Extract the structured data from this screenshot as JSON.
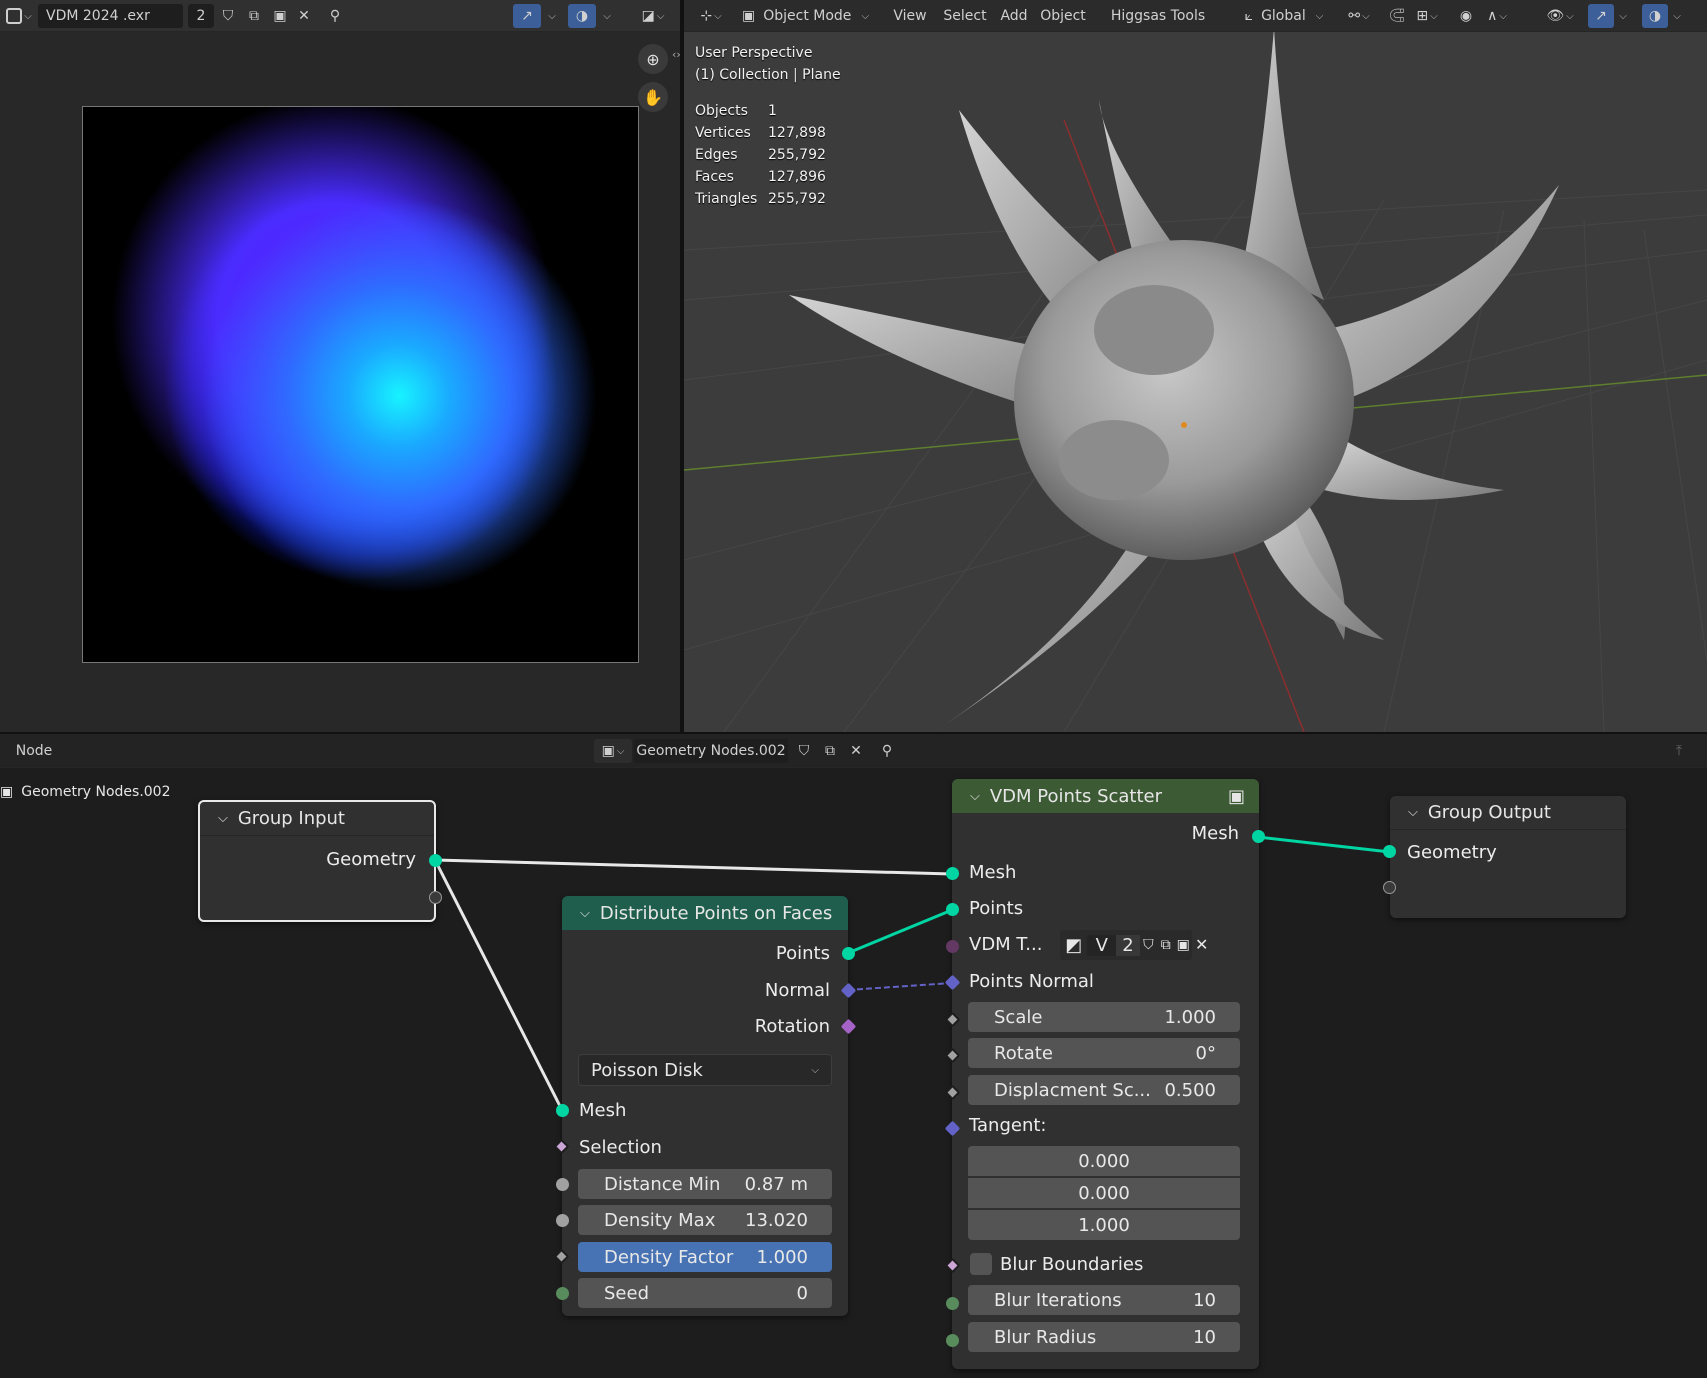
{
  "image_editor": {
    "image_name": "VDM 2024 .exr",
    "user_count": "2"
  },
  "viewport": {
    "mode": "Object Mode",
    "menus": [
      "View",
      "Select",
      "Add",
      "Object",
      "Higgsas Tools"
    ],
    "orientation": "Global",
    "perspective": "User Perspective",
    "collection": "(1) Collection",
    "object_name": "Plane",
    "stats": [
      {
        "label": "Objects",
        "value": "1"
      },
      {
        "label": "Vertices",
        "value": "127,898"
      },
      {
        "label": "Edges",
        "value": "255,792"
      },
      {
        "label": "Faces",
        "value": "127,896"
      },
      {
        "label": "Triangles",
        "value": "255,792"
      }
    ]
  },
  "node_editor": {
    "menu_label": "Node",
    "node_tree_name": "Geometry Nodes.002",
    "breadcrumb": "Geometry Nodes.002",
    "group_input": {
      "title": "Group Input",
      "geometry": "Geometry"
    },
    "distribute": {
      "title": "Distribute Points on Faces",
      "out_points": "Points",
      "out_normal": "Normal",
      "out_rotation": "Rotation",
      "method": "Poisson Disk",
      "in_mesh": "Mesh",
      "in_selection": "Selection",
      "distance_min_label": "Distance Min",
      "distance_min_value": "0.87 m",
      "density_max_label": "Density Max",
      "density_max_value": "13.020",
      "density_factor_label": "Density Factor",
      "density_factor_value": "1.000",
      "seed_label": "Seed",
      "seed_value": "0"
    },
    "vdm_scatter": {
      "title": "VDM Points Scatter",
      "out_mesh": "Mesh",
      "in_mesh": "Mesh",
      "in_points": "Points",
      "vdm_texture_label": "VDM T...",
      "vdm_image_short": "V",
      "vdm_users": "2",
      "points_normal": "Points Normal",
      "scale_label": "Scale",
      "scale_value": "1.000",
      "rotate_label": "Rotate",
      "rotate_value": "0°",
      "displacement_label": "Displacment Sc...",
      "displacement_value": "0.500",
      "tangent_label": "Tangent:",
      "tangent_x": "0.000",
      "tangent_y": "0.000",
      "tangent_z": "1.000",
      "blur_boundaries": "Blur Boundaries",
      "blur_iterations_label": "Blur Iterations",
      "blur_iterations_value": "10",
      "blur_radius_label": "Blur Radius",
      "blur_radius_value": "10"
    },
    "group_output": {
      "title": "Group Output",
      "geometry": "Geometry"
    }
  },
  "colors": {
    "geometry_socket": "#00d6a3",
    "vector_socket": "#6363c7",
    "distribute_header": "#1f5e4c",
    "vdm_header": "#3c5a34",
    "selected_field": "#4772b3"
  }
}
